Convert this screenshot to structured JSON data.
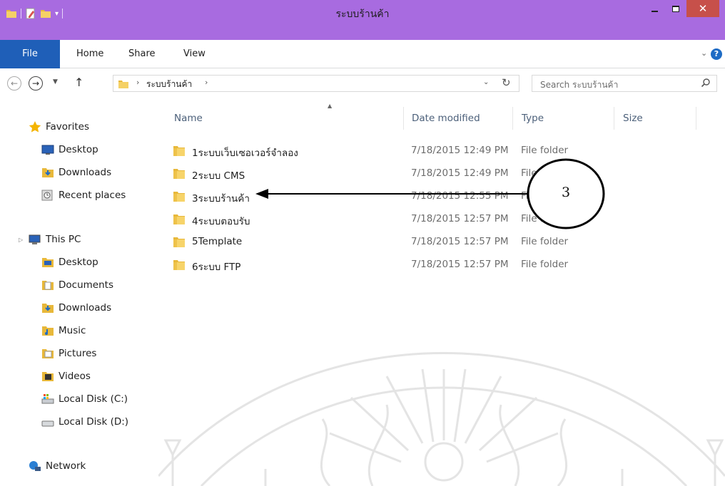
{
  "window": {
    "title": "ระบบร้านค้า",
    "close_glyph": "✕"
  },
  "ribbon": {
    "tabs": [
      "File",
      "Home",
      "Share",
      "View"
    ],
    "help_glyph": "?"
  },
  "address_bar": {
    "crumb": "ระบบร้านค้า",
    "separator_glyph": "›"
  },
  "search": {
    "placeholder": "Search ระบบร้านค้า"
  },
  "sidebar": {
    "favorites_label": "Favorites",
    "favorites": [
      "Desktop",
      "Downloads",
      "Recent places"
    ],
    "this_pc_label": "This PC",
    "this_pc": [
      "Desktop",
      "Documents",
      "Downloads",
      "Music",
      "Pictures",
      "Videos",
      "Local Disk (C:)",
      "Local Disk (D:)"
    ],
    "network_label": "Network"
  },
  "columns": {
    "name": "Name",
    "date": "Date modified",
    "type": "Type",
    "size": "Size"
  },
  "files": [
    {
      "name": "1ระบบเว็บเซอเวอร์จำลอง",
      "date": "7/18/2015 12:49 PM",
      "type": "File folder"
    },
    {
      "name": "2ระบบ CMS",
      "date": "7/18/2015 12:49 PM",
      "type": "File folder"
    },
    {
      "name": "3ระบบร้านค้า",
      "date": "7/18/2015 12:55 PM",
      "type": "File folder"
    },
    {
      "name": "4ระบบตอบรับ",
      "date": "7/18/2015 12:57 PM",
      "type": "File folder"
    },
    {
      "name": "5Template",
      "date": "7/18/2015 12:57 PM",
      "type": "File folder"
    },
    {
      "name": "6ระบบ FTP",
      "date": "7/18/2015 12:57 PM",
      "type": "File folder"
    }
  ],
  "annotation": {
    "callout_number": "3"
  },
  "colors": {
    "title_bar": "#a86be0",
    "file_tab": "#1f5fb8",
    "close_button": "#c7504a",
    "folder": "#e8b83a"
  },
  "icons": [
    "folder-icon",
    "star-icon",
    "desktop-icon",
    "downloads-icon",
    "recent-places-icon",
    "computer-icon",
    "documents-icon",
    "music-icon",
    "pictures-icon",
    "videos-icon",
    "drive-icon",
    "network-icon",
    "search-icon",
    "refresh-icon",
    "back-arrow-icon",
    "forward-arrow-icon",
    "up-arrow-icon"
  ]
}
